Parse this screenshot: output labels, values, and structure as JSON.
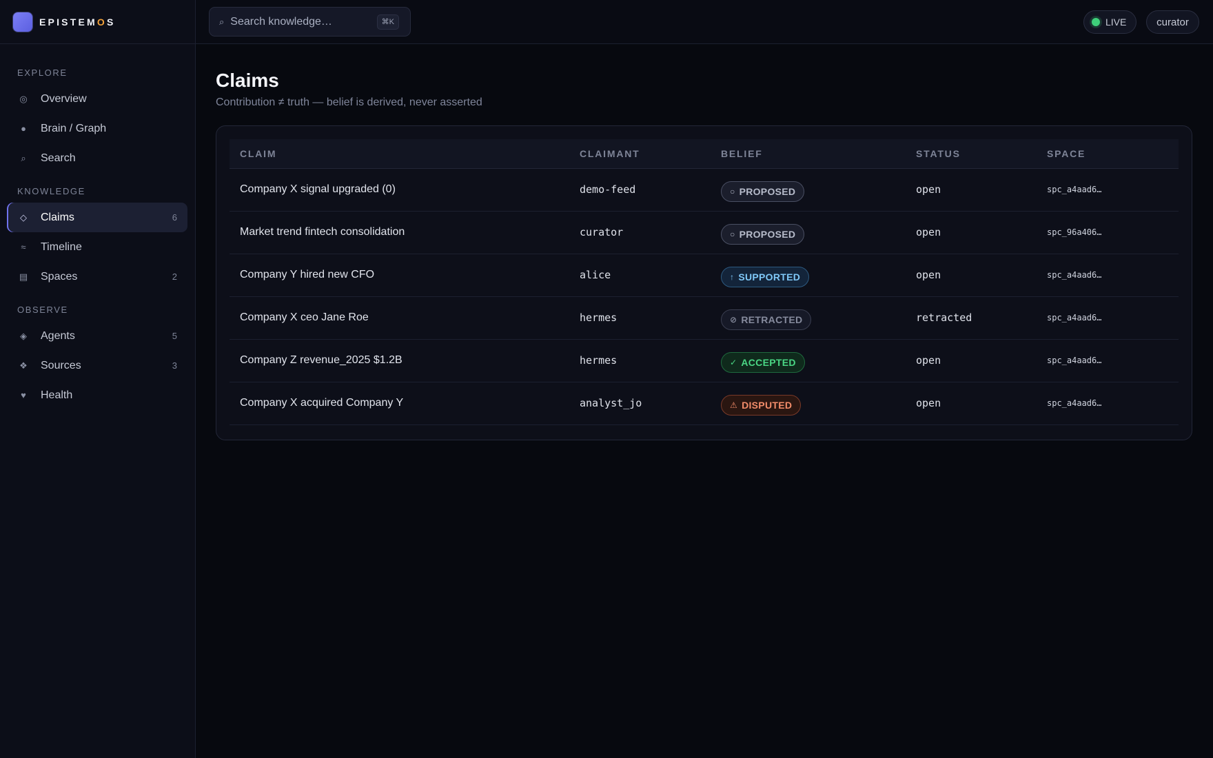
{
  "brand": {
    "name_part1": "EPISTEM",
    "name_accent": "O",
    "name_part2": "S"
  },
  "search": {
    "placeholder": "Search knowledge…",
    "shortcut": "⌘K"
  },
  "topbar": {
    "live_label": "LIVE",
    "user": "curator"
  },
  "sidebar": {
    "sections": [
      {
        "title": "EXPLORE",
        "items": [
          {
            "label": "Overview",
            "icon": "overview-icon",
            "count": ""
          },
          {
            "label": "Brain / Graph",
            "icon": "brain-icon",
            "count": ""
          },
          {
            "label": "Search",
            "icon": "search-icon",
            "count": ""
          }
        ]
      },
      {
        "title": "KNOWLEDGE",
        "items": [
          {
            "label": "Claims",
            "icon": "claims-icon",
            "count": "6",
            "active": true
          },
          {
            "label": "Timeline",
            "icon": "timeline-icon",
            "count": ""
          },
          {
            "label": "Spaces",
            "icon": "spaces-icon",
            "count": "2"
          }
        ]
      },
      {
        "title": "OBSERVE",
        "items": [
          {
            "label": "Agents",
            "icon": "agents-icon",
            "count": "5"
          },
          {
            "label": "Sources",
            "icon": "sources-icon",
            "count": "3"
          },
          {
            "label": "Health",
            "icon": "heart-icon",
            "count": ""
          }
        ]
      }
    ]
  },
  "page": {
    "title": "Claims",
    "subtitle": "Contribution ≠ truth — belief is derived, never asserted"
  },
  "table": {
    "columns": [
      "CLAIM",
      "CLAIMANT",
      "BELIEF",
      "STATUS",
      "SPACE"
    ],
    "rows": [
      {
        "claim": "Company X signal upgraded (0)",
        "claimant": "demo-feed",
        "belief": "PROPOSED",
        "belief_kind": "proposed",
        "status": "open",
        "space": "spc_a4aad6…"
      },
      {
        "claim": "Market trend fintech consolidation",
        "claimant": "curator",
        "belief": "PROPOSED",
        "belief_kind": "proposed",
        "status": "open",
        "space": "spc_96a406…"
      },
      {
        "claim": "Company Y hired new CFO",
        "claimant": "alice",
        "belief": "SUPPORTED",
        "belief_kind": "supported",
        "status": "open",
        "space": "spc_a4aad6…"
      },
      {
        "claim": "Company X ceo Jane Roe",
        "claimant": "hermes",
        "belief": "RETRACTED",
        "belief_kind": "retracted",
        "status": "retracted",
        "space": "spc_a4aad6…"
      },
      {
        "claim": "Company Z revenue_2025 $1.2B",
        "claimant": "hermes",
        "belief": "ACCEPTED",
        "belief_kind": "accepted",
        "status": "open",
        "space": "spc_a4aad6…"
      },
      {
        "claim": "Company X acquired Company Y",
        "claimant": "analyst_jo",
        "belief": "DISPUTED",
        "belief_kind": "disputed",
        "status": "open",
        "space": "spc_a4aad6…"
      }
    ]
  },
  "colors": {
    "accent": "#7073ee",
    "brand_accent": "#f5a33b",
    "live": "#3ed07a",
    "supported": "#7fc8f8",
    "accepted": "#4ad684",
    "disputed": "#f28c6a"
  }
}
